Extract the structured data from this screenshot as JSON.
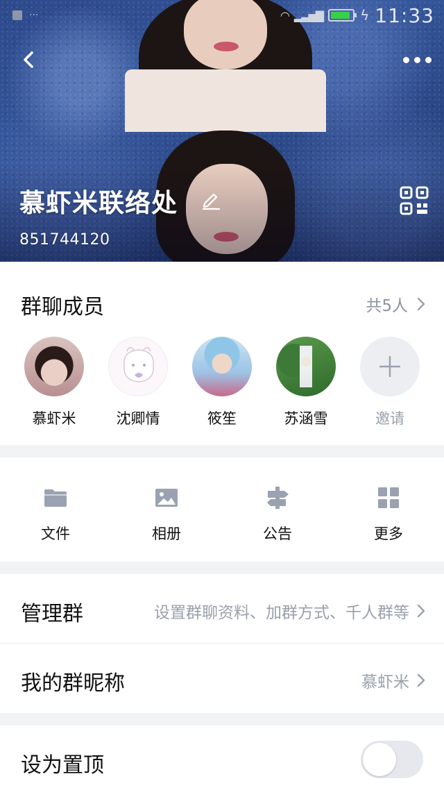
{
  "status_bar": {
    "time": "11:33"
  },
  "header": {
    "group_name": "慕虾米联络处",
    "group_id": "851744120"
  },
  "members": {
    "title": "群聊成员",
    "count_label": "共5人",
    "list": [
      {
        "name": "慕虾米"
      },
      {
        "name": "沈卿情"
      },
      {
        "name": "筱笙"
      },
      {
        "name": "苏涵雪"
      }
    ],
    "invite_label": "邀请"
  },
  "tools": [
    {
      "label": "文件",
      "icon": "folder-icon"
    },
    {
      "label": "相册",
      "icon": "image-icon"
    },
    {
      "label": "公告",
      "icon": "signpost-icon"
    },
    {
      "label": "更多",
      "icon": "grid-icon"
    }
  ],
  "settings": {
    "manage_group": {
      "label": "管理群",
      "value": "设置群聊资料、加群方式、千人群等"
    },
    "my_nickname": {
      "label": "我的群昵称",
      "value": "慕虾米"
    },
    "pin_top": {
      "label": "设为置顶",
      "enabled": false
    }
  },
  "colors": {
    "header_blue": "#2d4a8c",
    "muted_text": "#9aa0ab",
    "icon_gray": "#9aa2b1",
    "toggle_off": "#e6e8ee"
  }
}
